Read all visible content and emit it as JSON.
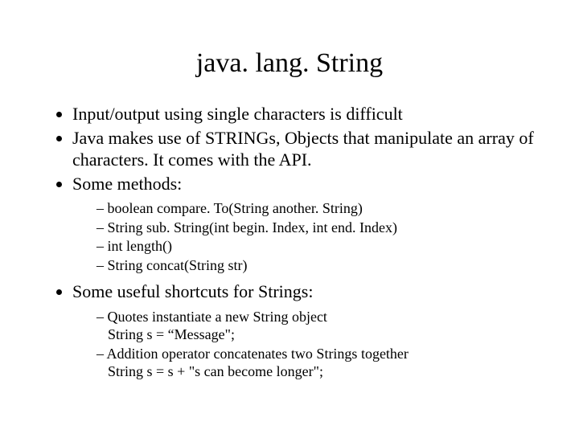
{
  "title": "java. lang. String",
  "bullets": {
    "b1": "Input/output using single characters is difficult",
    "b2": "Java makes use of STRINGs, Objects that manipulate an array of characters. It comes with the API.",
    "b3": "Some methods:",
    "b4": "Some useful shortcuts for Strings:"
  },
  "methods": {
    "m1": "boolean compare. To(String another. String)",
    "m2": "String sub. String(int begin. Index, int end. Index)",
    "m3": "int length()",
    "m4": "String concat(String str)"
  },
  "shortcuts": {
    "s1a": "Quotes instantiate a new String object",
    "s1b": "String s = “Message\";",
    "s2a": "Addition operator concatenates two Strings together",
    "s2b": "String s = s + \"s can become longer\";"
  }
}
